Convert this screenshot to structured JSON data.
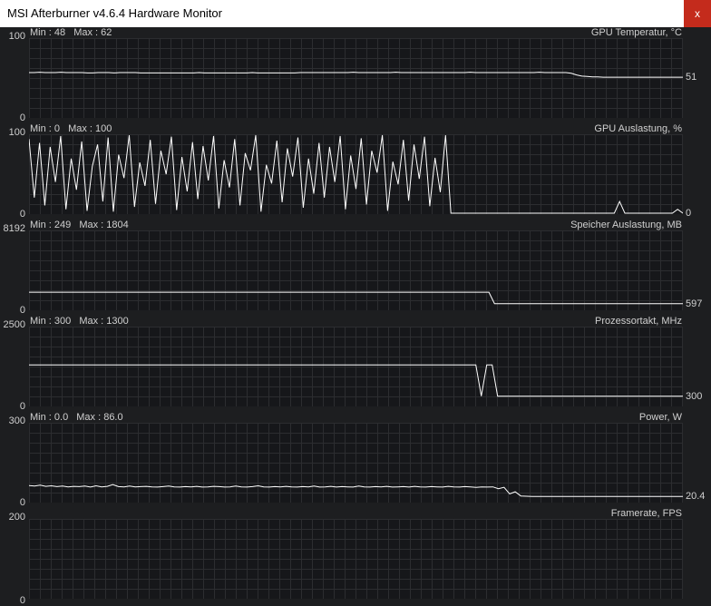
{
  "window": {
    "title": "MSI Afterburner v4.6.4 Hardware Monitor",
    "close_label": "x"
  },
  "panels": [
    {
      "title": "GPU Temperatur, °C",
      "min_label": "Min : 48",
      "max_label": "Max : 62",
      "y_top": "100",
      "y_bottom": "0",
      "current": "51",
      "range": [
        0,
        100
      ],
      "series": [
        57,
        57,
        57.5,
        57,
        57,
        57,
        57.5,
        57,
        57,
        57,
        57,
        56.5,
        56.5,
        57,
        57,
        57,
        56.5,
        57,
        57,
        57,
        57,
        56.5,
        56.5,
        56.5,
        56.5,
        56.5,
        56.5,
        56.5,
        56.5,
        56.5,
        56.5,
        56.5,
        57,
        56.5,
        56.5,
        56.5,
        56.5,
        56.5,
        56.5,
        56.5,
        56.5,
        56.5,
        57,
        56.5,
        56.5,
        56.5,
        56.5,
        56.5,
        56.5,
        56.5,
        56.5,
        57,
        57,
        57,
        57,
        57,
        57,
        57,
        57,
        57,
        57,
        57.5,
        57,
        57,
        57,
        57,
        57,
        57,
        57,
        57.5,
        57,
        57,
        57,
        57,
        57,
        57,
        57,
        57,
        57,
        57,
        57,
        57,
        57,
        57.5,
        57,
        57,
        57,
        57,
        57,
        57,
        57,
        57,
        57,
        57,
        57,
        57,
        57.5,
        57,
        57,
        57,
        57,
        57,
        56,
        54,
        52.5,
        52,
        51.5,
        51.5,
        51,
        51,
        51,
        51,
        51,
        51,
        51,
        51,
        51,
        51,
        51,
        51,
        51,
        51,
        51,
        51
      ]
    },
    {
      "title": "GPU Auslastung, %",
      "min_label": "Min : 0",
      "max_label": "Max : 100",
      "y_top": "100",
      "y_bottom": "0",
      "current": "0",
      "range": [
        0,
        100
      ],
      "series": [
        95,
        20,
        90,
        10,
        85,
        40,
        99,
        5,
        70,
        30,
        92,
        3,
        60,
        88,
        15,
        97,
        2,
        75,
        45,
        100,
        8,
        65,
        35,
        94,
        12,
        80,
        50,
        98,
        4,
        72,
        28,
        91,
        18,
        86,
        42,
        99,
        6,
        68,
        33,
        95,
        10,
        77,
        55,
        100,
        2,
        62,
        38,
        93,
        14,
        83,
        47,
        97,
        7,
        70,
        25,
        90,
        20,
        85,
        40,
        99,
        5,
        74,
        31,
        96,
        11,
        80,
        52,
        100,
        3,
        66,
        37,
        94,
        16,
        88,
        44,
        98,
        9,
        71,
        27,
        100,
        0,
        0,
        0,
        0,
        0,
        0,
        0,
        0,
        0,
        0,
        0,
        0,
        0,
        0,
        0,
        0,
        0,
        0,
        0,
        0,
        0,
        0,
        0,
        0,
        0,
        0,
        0,
        0,
        0,
        0,
        0,
        0,
        15,
        0,
        0,
        0,
        0,
        0,
        0,
        0,
        0,
        0,
        0,
        5,
        0
      ]
    },
    {
      "title": "Speicher Auslastung, MB",
      "min_label": "Min : 249",
      "max_label": "Max : 1804",
      "y_top": "8192",
      "y_bottom": "0",
      "current": "597",
      "range": [
        0,
        8192
      ],
      "series": [
        1804,
        1804,
        1804,
        1804,
        1804,
        1804,
        1804,
        1804,
        1804,
        1804,
        1804,
        1804,
        1804,
        1804,
        1804,
        1804,
        1804,
        1804,
        1804,
        1804,
        1804,
        1804,
        1804,
        1804,
        1804,
        1804,
        1804,
        1804,
        1804,
        1804,
        1804,
        1804,
        1804,
        1804,
        1804,
        1804,
        1804,
        1804,
        1804,
        1804,
        1804,
        1804,
        1804,
        1804,
        1804,
        1804,
        1804,
        1804,
        1804,
        1804,
        1804,
        1804,
        1804,
        1804,
        1804,
        1804,
        1804,
        1804,
        1804,
        1804,
        1804,
        1804,
        1804,
        1804,
        1804,
        1804,
        1804,
        1804,
        1804,
        1804,
        1804,
        1804,
        1804,
        1804,
        1804,
        1804,
        1804,
        1804,
        1804,
        1804,
        1804,
        1804,
        1804,
        1804,
        600,
        597,
        597,
        597,
        597,
        597,
        597,
        597,
        597,
        597,
        597,
        597,
        597,
        597,
        597,
        597,
        597,
        597,
        597,
        597,
        597,
        597,
        597,
        597,
        597,
        597,
        597,
        597,
        597,
        597,
        597,
        597,
        597,
        597,
        597
      ]
    },
    {
      "title": "Prozessortakt, MHz",
      "min_label": "Min : 300",
      "max_label": "Max : 1300",
      "y_top": "2500",
      "y_bottom": "0",
      "current": "300",
      "range": [
        0,
        2500
      ],
      "series": [
        1300,
        1300,
        1300,
        1300,
        1300,
        1300,
        1300,
        1300,
        1300,
        1300,
        1300,
        1300,
        1300,
        1300,
        1300,
        1300,
        1300,
        1300,
        1300,
        1300,
        1300,
        1300,
        1300,
        1300,
        1300,
        1300,
        1300,
        1300,
        1300,
        1300,
        1300,
        1300,
        1300,
        1300,
        1300,
        1300,
        1300,
        1300,
        1300,
        1300,
        1300,
        1300,
        1300,
        1300,
        1300,
        1300,
        1300,
        1300,
        1300,
        1300,
        1300,
        1300,
        1300,
        1300,
        1300,
        1300,
        1300,
        1300,
        1300,
        1300,
        1300,
        1300,
        1300,
        1300,
        1300,
        1300,
        1300,
        1300,
        1300,
        1300,
        1300,
        1300,
        1300,
        1300,
        1300,
        1300,
        1300,
        1300,
        1300,
        1300,
        1300,
        1300,
        1300,
        300,
        1300,
        1300,
        300,
        300,
        300,
        300,
        300,
        300,
        300,
        300,
        300,
        300,
        300,
        300,
        300,
        300,
        300,
        300,
        300,
        300,
        300,
        300,
        300,
        300,
        300,
        300,
        300,
        300,
        300,
        300,
        300,
        300,
        300,
        300,
        300,
        300,
        300
      ]
    },
    {
      "title": "Power, W",
      "min_label": "Min : 0.0",
      "max_label": "Max : 86.0",
      "y_top": "300",
      "y_bottom": "0",
      "current": "20.4",
      "range": [
        0,
        300
      ],
      "series": [
        62,
        60,
        64,
        59,
        61,
        58,
        60,
        57,
        59,
        58,
        60,
        56,
        61,
        57,
        59,
        66,
        58,
        57,
        60,
        57,
        58,
        59,
        57,
        56,
        58,
        60,
        57,
        56,
        58,
        57,
        59,
        56,
        57,
        59,
        58,
        56,
        57,
        60,
        57,
        56,
        58,
        61,
        57,
        56,
        58,
        57,
        59,
        57,
        56,
        58,
        57,
        60,
        56,
        57,
        59,
        56,
        58,
        57,
        56,
        60,
        57,
        56,
        58,
        57,
        59,
        56,
        57,
        58,
        56,
        59,
        57,
        56,
        58,
        57,
        56,
        59,
        57,
        56,
        58,
        57,
        55,
        57,
        56,
        57,
        50,
        55,
        30,
        38,
        22,
        21,
        20.4,
        20.4,
        20.4,
        20.4,
        20.4,
        20.4,
        20.4,
        20.4,
        20.4,
        20.4,
        20.4,
        20.4,
        20.4,
        20.4,
        20.4,
        20.4,
        20.4,
        20.4,
        20.4,
        20.4,
        20.4,
        20.4,
        20.4,
        20.4,
        20.4,
        20.4,
        20.4,
        20.4
      ]
    },
    {
      "title": "Framerate, FPS",
      "min_label": "",
      "max_label": "",
      "y_top": "200",
      "y_bottom": "0",
      "current": "",
      "range": [
        0,
        200
      ],
      "series": []
    }
  ],
  "colors": {
    "background": "#1d1e20",
    "plot_background": "#16171a",
    "grid": "#2c2d30",
    "trace": "#ffffff",
    "close_button": "#c42b1c"
  }
}
